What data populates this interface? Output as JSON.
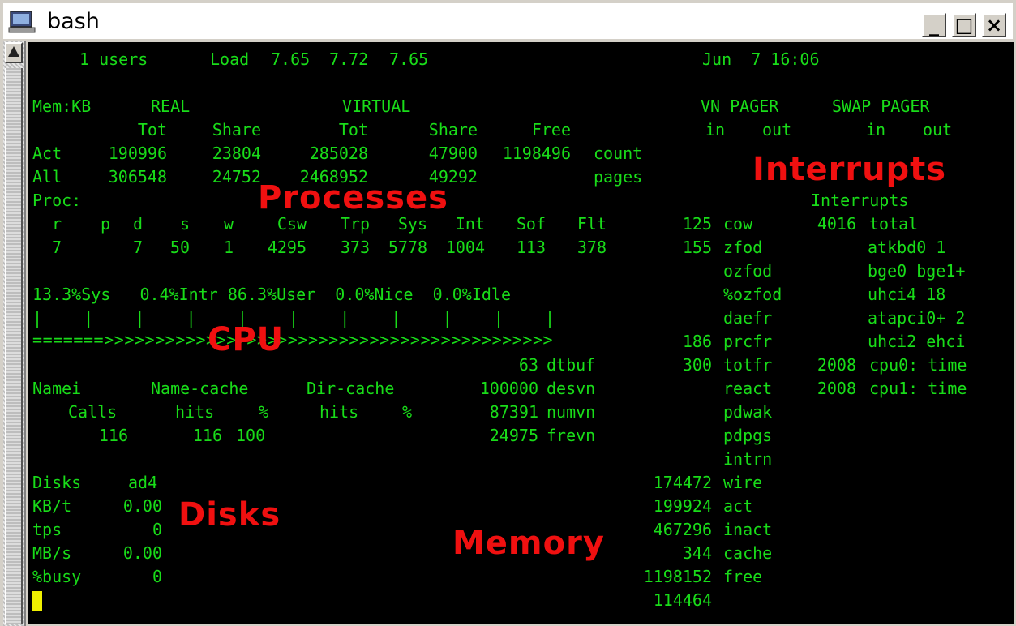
{
  "window": {
    "title": "bash",
    "minimize_label": "_",
    "maximize_label": "□",
    "close_label": "×"
  },
  "header": {
    "users": "1 users",
    "load_label": "Load",
    "load1": "7.65",
    "load5": "7.72",
    "load15": "7.65",
    "date": "Jun  7 16:06"
  },
  "mem": {
    "title": "Mem:KB",
    "real": "REAL",
    "virtual": "VIRTUAL",
    "tot1": "Tot",
    "share1": "Share",
    "tot2": "Tot",
    "share2": "Share",
    "free": "Free",
    "act_label": "Act",
    "act_tot": "190996",
    "act_share": "23804",
    "act_vtot": "285028",
    "act_vshare": "47900",
    "act_free": "1198496",
    "count": "count",
    "all_label": "All",
    "all_tot": "306548",
    "all_share": "24752",
    "all_vtot": "2468952",
    "all_vshare": "49292",
    "pages": "pages"
  },
  "pager": {
    "vn": "VN PAGER",
    "swap": "SWAP PAGER",
    "vn_in": "in",
    "vn_out": "out",
    "sw_in": "in",
    "sw_out": "out"
  },
  "proc": {
    "label": "Proc:",
    "headers": [
      "r",
      "p",
      "d",
      "s",
      "w",
      "Csw",
      "Trp",
      "Sys",
      "Int",
      "Sof",
      "Flt"
    ],
    "values": [
      "7",
      "",
      "7",
      "50",
      "1",
      "4295",
      "373",
      "5778",
      "1004",
      "113",
      "378"
    ]
  },
  "cpu": {
    "stats": "13.3%Sys   0.4%Intr 86.3%User  0.0%Nice  0.0%Idle",
    "ticks": "|    |    |    |    |    |    |    |    |    |    |",
    "bar": "=======>>>>>>>>>>>>>>>>>>>>>>>>>>>>>>>>>>>>>>>>>>>>"
  },
  "vmstat": [
    {
      "value": "125",
      "label": "cow"
    },
    {
      "value": "155",
      "label": "zfod"
    },
    {
      "value": "",
      "label": "ozfod"
    },
    {
      "value": "",
      "label": "%ozfod"
    },
    {
      "value": "",
      "label": "daefr"
    },
    {
      "value": "186",
      "label": "prcfr"
    },
    {
      "value": "300",
      "label": "totfr"
    },
    {
      "value": "",
      "label": "react"
    },
    {
      "value": "",
      "label": "pdwak"
    },
    {
      "value": "",
      "label": "pdpgs"
    },
    {
      "value": "",
      "label": "intrn"
    }
  ],
  "memory_stats": [
    {
      "value": "174472",
      "label": "wire"
    },
    {
      "value": "199924",
      "label": "act"
    },
    {
      "value": "467296",
      "label": "inact"
    },
    {
      "value": "344",
      "label": "cache"
    },
    {
      "value": "1198152",
      "label": "free"
    },
    {
      "value": "114464",
      "label": ""
    }
  ],
  "vnodes": [
    {
      "value": "63",
      "label": "dtbuf"
    },
    {
      "value": "100000",
      "label": "desvn"
    },
    {
      "value": "87391",
      "label": "numvn"
    },
    {
      "value": "24975",
      "label": "frevn"
    }
  ],
  "interrupts": {
    "title": "Interrupts",
    "total_value": "4016",
    "total_label": "total",
    "items": [
      {
        "value": "",
        "label": "atkbd0 1"
      },
      {
        "value": "",
        "label": "bge0 bge1+"
      },
      {
        "value": "",
        "label": "uhci4 18"
      },
      {
        "value": "",
        "label": "atapci0+ 2"
      },
      {
        "value": "",
        "label": "uhci2 ehci"
      },
      {
        "value": "2008",
        "label": "cpu0: time"
      },
      {
        "value": "2008",
        "label": "cpu1: time"
      }
    ]
  },
  "namei": {
    "namei": "Namei",
    "name_cache": "Name-cache",
    "dir_cache": "Dir-cache",
    "calls": "Calls",
    "hits1": "hits",
    "pct1": "%",
    "hits2": "hits",
    "pct2": "%",
    "calls_val": "116",
    "hits1_val": "116",
    "pct1_val": "100"
  },
  "disks": {
    "disks_label": "Disks",
    "device": "ad4",
    "rows": [
      {
        "label": "KB/t",
        "value": "0.00"
      },
      {
        "label": "tps",
        "value": "0"
      },
      {
        "label": "MB/s",
        "value": "0.00"
      },
      {
        "label": "%busy",
        "value": "0"
      }
    ]
  },
  "annotations": {
    "processes": "Processes",
    "interrupts": "Interrupts",
    "cpu": "CPU",
    "disks": "Disks",
    "memory": "Memory"
  },
  "colors": {
    "terminal_fg": "#19dc19",
    "terminal_bg": "#000000",
    "annotation": "#f01010",
    "cursor": "#f0f000"
  }
}
